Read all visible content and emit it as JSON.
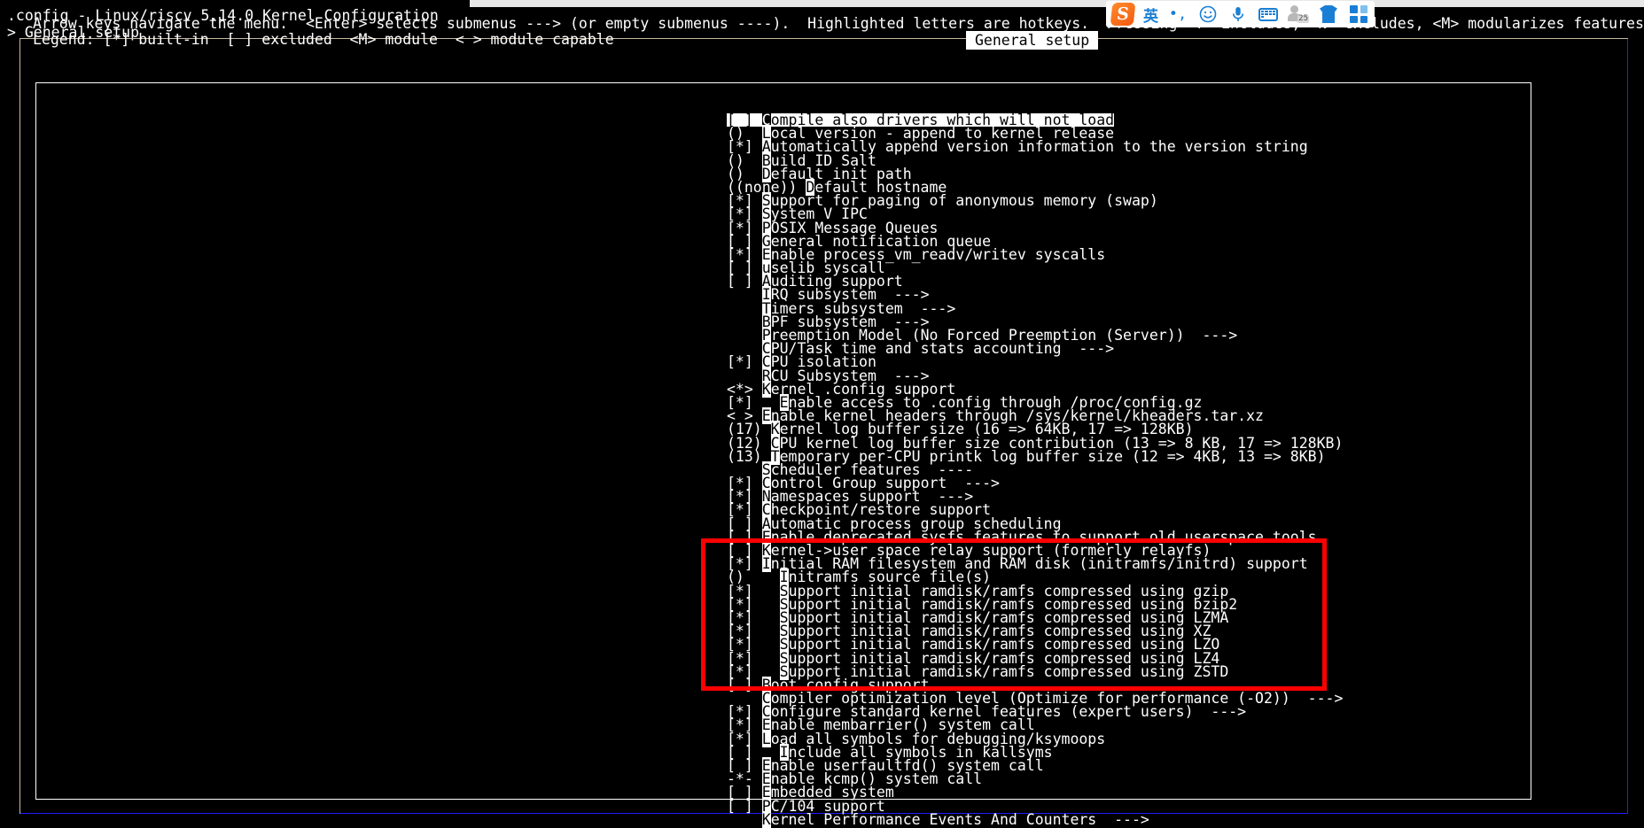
{
  "window": {
    "title": ".config - Linux/riscv 5.14.0 Kernel Configuration",
    "breadcrumb": "> General setup",
    "frame_label": "General setup"
  },
  "help": {
    "line1": "Arrow keys navigate the menu.  <Enter> selects submenus ---> (or empty submenus ----).  Highlighted letters are hotkeys.  Pressing <Y> includes, <N> excludes, <M> modularizes features.  Press <Esc><Esc",
    "line2": "Legend: [*] built-in  [ ] excluded  <M> module  < > module capable"
  },
  "ime": {
    "logo_label": "S",
    "mode_label": "英",
    "punct_label": "•,",
    "emoji_icon": "smiley-icon",
    "mic_icon": "microphone-icon",
    "keyboard_icon": "keyboard-icon",
    "account_icon": "account-icon",
    "account_badge": "25",
    "skin_icon": "skin-icon",
    "apps_icon": "apps-grid-icon",
    "accent": "#1a7fd4",
    "logo_color": "#f35a12"
  },
  "colors": {
    "background": "#000000",
    "text": "#ffffff",
    "highlight_bg": "#ffffff",
    "highlight_fg": "#000000",
    "frame_blue": "#1e1eff",
    "frame_white": "#ffffff",
    "annotation_red": "#ff0000"
  },
  "menu": {
    "rows": [
      {
        "mark": "[ ] ",
        "pre": "",
        "hot": "C",
        "text": "ompile also drivers which will not load",
        "selected": true
      },
      {
        "mark": "()  ",
        "pre": "",
        "hot": "L",
        "text": "ocal version - append to kernel release",
        "selected": false
      },
      {
        "mark": "[*] ",
        "pre": "",
        "hot": "A",
        "text": "utomatically append version information to the version string",
        "selected": false
      },
      {
        "mark": "()  ",
        "pre": "",
        "hot": "B",
        "text": "uild ID Salt",
        "selected": false
      },
      {
        "mark": "()  ",
        "pre": "",
        "hot": "D",
        "text": "efault init path",
        "selected": false
      },
      {
        "mark": "((none)) ",
        "pre": "",
        "hot": "D",
        "text": "efault hostname",
        "selected": false
      },
      {
        "mark": "[*] ",
        "pre": "",
        "hot": "S",
        "text": "upport for paging of anonymous memory (swap)",
        "selected": false
      },
      {
        "mark": "[*] ",
        "pre": "",
        "hot": "S",
        "text": "ystem V IPC",
        "selected": false
      },
      {
        "mark": "[*] ",
        "pre": "",
        "hot": "P",
        "text": "OSIX Message Queues",
        "selected": false
      },
      {
        "mark": "[ ] ",
        "pre": "",
        "hot": "G",
        "text": "eneral notification queue",
        "selected": false
      },
      {
        "mark": "[*] ",
        "pre": "",
        "hot": "E",
        "text": "nable process_vm_readv/writev syscalls",
        "selected": false
      },
      {
        "mark": "[ ] ",
        "pre": "",
        "hot": "u",
        "text": "selib syscall",
        "selected": false
      },
      {
        "mark": "[ ] ",
        "pre": "",
        "hot": "A",
        "text": "uditing support",
        "selected": false
      },
      {
        "mark": "    ",
        "pre": "",
        "hot": "I",
        "text": "RQ subsystem  --->",
        "selected": false
      },
      {
        "mark": "    ",
        "pre": "",
        "hot": "T",
        "text": "imers subsystem  --->",
        "selected": false
      },
      {
        "mark": "    ",
        "pre": "",
        "hot": "B",
        "text": "PF subsystem  --->",
        "selected": false
      },
      {
        "mark": "    ",
        "pre": "",
        "hot": "P",
        "text": "reemption Model (No Forced Preemption (Server))  --->",
        "selected": false
      },
      {
        "mark": "    ",
        "pre": "",
        "hot": "C",
        "text": "PU/Task time and stats accounting  --->",
        "selected": false
      },
      {
        "mark": "[*] ",
        "pre": "",
        "hot": "C",
        "text": "PU isolation",
        "selected": false
      },
      {
        "mark": "    ",
        "pre": "",
        "hot": "R",
        "text": "CU Subsystem  --->",
        "selected": false
      },
      {
        "mark": "<*> ",
        "pre": "",
        "hot": "K",
        "text": "ernel .config support",
        "selected": false
      },
      {
        "mark": "[*] ",
        "pre": "  ",
        "hot": "E",
        "text": "nable access to .config through /proc/config.gz",
        "selected": false
      },
      {
        "mark": "< > ",
        "pre": "",
        "hot": "E",
        "text": "nable kernel headers through /sys/kernel/kheaders.tar.xz",
        "selected": false
      },
      {
        "mark": "(17) ",
        "pre": "",
        "hot": "K",
        "text": "ernel log buffer size (16 => 64KB, 17 => 128KB)",
        "selected": false
      },
      {
        "mark": "(12) ",
        "pre": "",
        "hot": "C",
        "text": "PU kernel log buffer size contribution (13 => 8 KB, 17 => 128KB)",
        "selected": false
      },
      {
        "mark": "(13) ",
        "pre": "",
        "hot": "T",
        "text": "emporary per-CPU printk log buffer size (12 => 4KB, 13 => 8KB)",
        "selected": false
      },
      {
        "mark": "    ",
        "pre": "",
        "hot": "S",
        "text": "cheduler features  ----",
        "selected": false
      },
      {
        "mark": "[*] ",
        "pre": "",
        "hot": "C",
        "text": "ontrol Group support  --->",
        "selected": false
      },
      {
        "mark": "[*] ",
        "pre": "",
        "hot": "N",
        "text": "amespaces support  --->",
        "selected": false
      },
      {
        "mark": "[*] ",
        "pre": "",
        "hot": "C",
        "text": "heckpoint/restore support",
        "selected": false
      },
      {
        "mark": "[ ] ",
        "pre": "",
        "hot": "A",
        "text": "utomatic process group scheduling",
        "selected": false
      },
      {
        "mark": "[ ] ",
        "pre": "",
        "hot": "E",
        "text": "nable deprecated sysfs features to support old userspace tools",
        "selected": false
      },
      {
        "mark": "[ ] ",
        "pre": "",
        "hot": "K",
        "text": "ernel->user space relay support (formerly relayfs)",
        "selected": false
      },
      {
        "mark": "[*] ",
        "pre": "",
        "hot": "I",
        "text": "nitial RAM filesystem and RAM disk (initramfs/initrd) support",
        "selected": false
      },
      {
        "mark": "()  ",
        "pre": "  ",
        "hot": "I",
        "text": "nitramfs source file(s)",
        "selected": false
      },
      {
        "mark": "[*] ",
        "pre": "  ",
        "hot": "S",
        "text": "upport initial ramdisk/ramfs compressed using gzip",
        "selected": false
      },
      {
        "mark": "[*] ",
        "pre": "  ",
        "hot": "S",
        "text": "upport initial ramdisk/ramfs compressed using bzip2",
        "selected": false
      },
      {
        "mark": "[*] ",
        "pre": "  ",
        "hot": "S",
        "text": "upport initial ramdisk/ramfs compressed using LZMA",
        "selected": false
      },
      {
        "mark": "[*] ",
        "pre": "  ",
        "hot": "S",
        "text": "upport initial ramdisk/ramfs compressed using XZ",
        "selected": false
      },
      {
        "mark": "[*] ",
        "pre": "  ",
        "hot": "S",
        "text": "upport initial ramdisk/ramfs compressed using LZO",
        "selected": false
      },
      {
        "mark": "[*] ",
        "pre": "  ",
        "hot": "S",
        "text": "upport initial ramdisk/ramfs compressed using LZ4",
        "selected": false
      },
      {
        "mark": "[*] ",
        "pre": "  ",
        "hot": "S",
        "text": "upport initial ramdisk/ramfs compressed using ZSTD",
        "selected": false
      },
      {
        "mark": "[ ] ",
        "pre": "",
        "hot": "B",
        "text": "oot config support",
        "selected": false
      },
      {
        "mark": "    ",
        "pre": "",
        "hot": "C",
        "text": "ompiler optimization level (Optimize for performance (-O2))  --->",
        "selected": false
      },
      {
        "mark": "[*] ",
        "pre": "",
        "hot": "C",
        "text": "onfigure standard kernel features (expert users)  --->",
        "selected": false
      },
      {
        "mark": "[*] ",
        "pre": "",
        "hot": "E",
        "text": "nable membarrier() system call",
        "selected": false
      },
      {
        "mark": "[*] ",
        "pre": "",
        "hot": "L",
        "text": "oad all symbols for debugging/ksymoops",
        "selected": false
      },
      {
        "mark": "[ ] ",
        "pre": "  ",
        "hot": "I",
        "text": "nclude all symbols in kallsyms",
        "selected": false
      },
      {
        "mark": "[ ] ",
        "pre": "",
        "hot": "E",
        "text": "nable userfaultfd() system call",
        "selected": false
      },
      {
        "mark": "-*- ",
        "pre": "",
        "hot": "E",
        "text": "nable kcmp() system call",
        "selected": false
      },
      {
        "mark": "[ ] ",
        "pre": "",
        "hot": "E",
        "text": "mbedded system",
        "selected": false
      },
      {
        "mark": "[ ] ",
        "pre": "",
        "hot": "P",
        "text": "C/104 support",
        "selected": false
      },
      {
        "mark": "    ",
        "pre": "",
        "hot": "K",
        "text": "ernel Performance Events And Counters  --->",
        "selected": false
      }
    ]
  },
  "annotation": {
    "shape": "rectangle",
    "color": "#ff0000",
    "highlights_rows": "Kernel->user space relay support through Boot config support"
  }
}
